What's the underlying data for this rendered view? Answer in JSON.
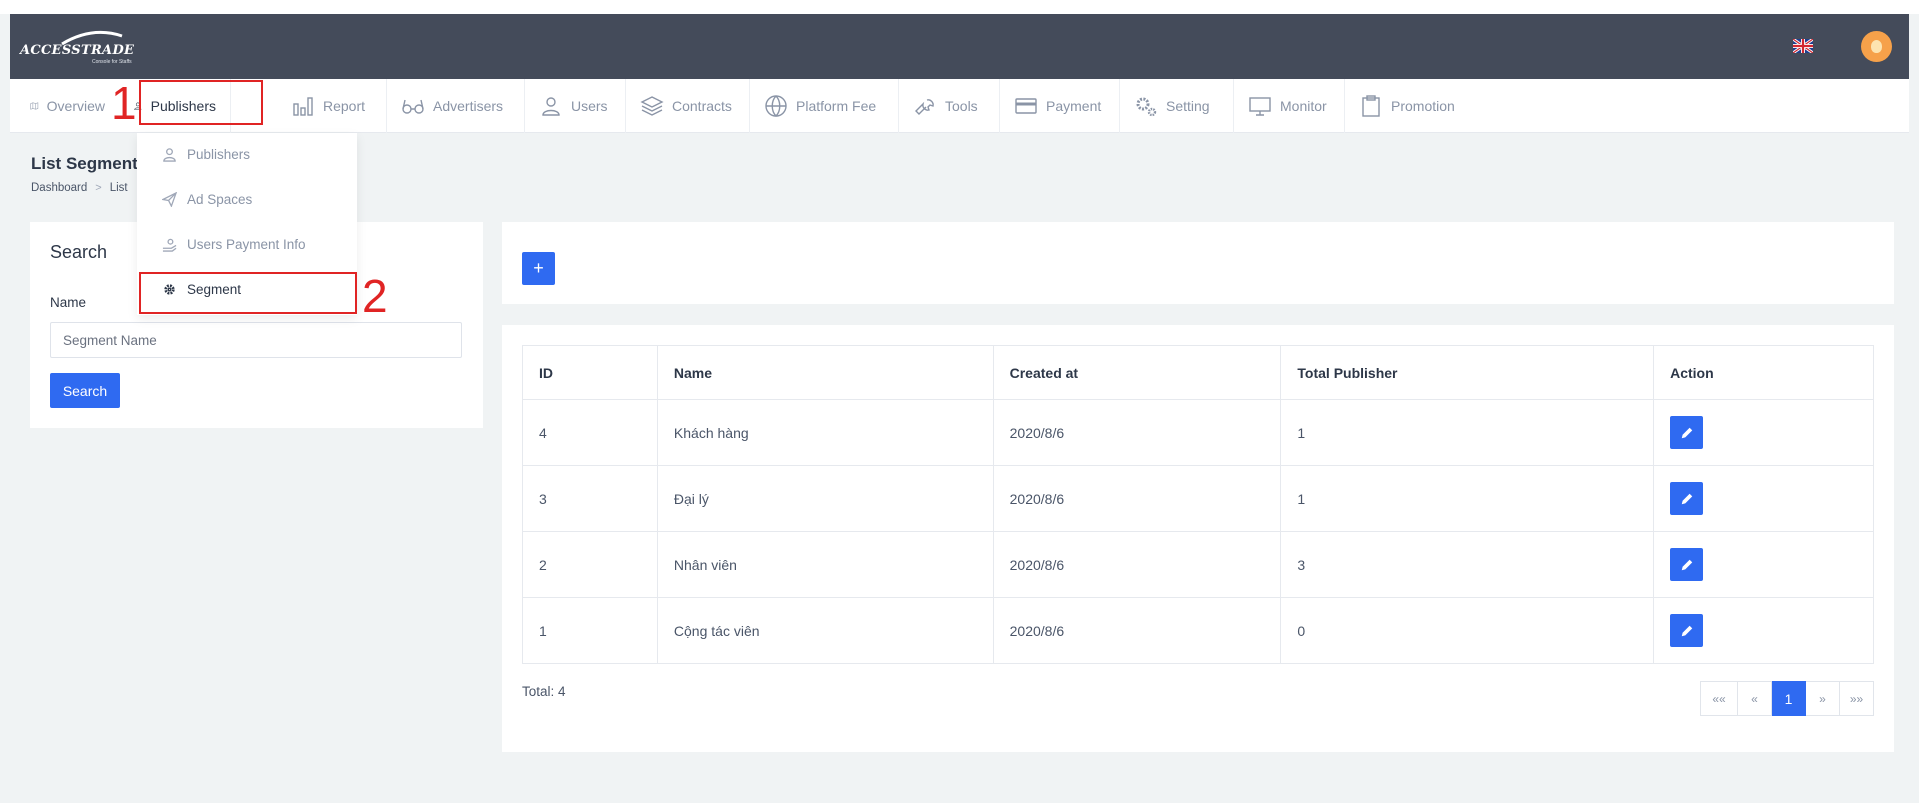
{
  "brand": {
    "logo_text": "ACCESSTRADE",
    "logo_subtext": "Console for Staffs"
  },
  "colors": {
    "topbar": "#444b5a",
    "primary": "#2f6af1",
    "annotation": "#e02424",
    "avatar": "#f6a14a"
  },
  "nav": {
    "items": [
      {
        "label": "Overview",
        "icon": "map-icon"
      },
      {
        "label": "Publishers",
        "icon": "users-icon"
      },
      {
        "label": "Report",
        "icon": "bar-chart-icon"
      },
      {
        "label": "Advertisers",
        "icon": "glasses-icon"
      },
      {
        "label": "Users",
        "icon": "user-icon"
      },
      {
        "label": "Contracts",
        "icon": "layers-icon"
      },
      {
        "label": "Platform Fee",
        "icon": "globe-icon"
      },
      {
        "label": "Tools",
        "icon": "wrench-icon"
      },
      {
        "label": "Payment",
        "icon": "credit-card-icon"
      },
      {
        "label": "Setting",
        "icon": "gears-icon"
      },
      {
        "label": "Monitor",
        "icon": "monitor-icon"
      },
      {
        "label": "Promotion",
        "icon": "clipboard-icon"
      }
    ],
    "active_index": 1
  },
  "dropdown": {
    "items": [
      {
        "label": "Publishers",
        "icon": "users-icon"
      },
      {
        "label": "Ad Spaces",
        "icon": "paper-plane-icon"
      },
      {
        "label": "Users Payment Info",
        "icon": "hand-money-icon"
      },
      {
        "label": "Segment",
        "icon": "gear-icon"
      }
    ],
    "active_index": 3
  },
  "annotations": {
    "step1": "1",
    "step2": "2"
  },
  "page": {
    "title": "List Segment",
    "breadcrumb": [
      "Dashboard",
      "List"
    ]
  },
  "search": {
    "title": "Search",
    "name_label": "Name",
    "name_placeholder": "Segment Name",
    "name_value": "",
    "button_label": "Search"
  },
  "add_button_label": "+",
  "table": {
    "headers": [
      "ID",
      "Name",
      "Created at",
      "Total Publisher",
      "Action"
    ],
    "rows": [
      {
        "id": "4",
        "name": "Khách hàng",
        "created_at": "2020/8/6",
        "total_publisher": "1"
      },
      {
        "id": "3",
        "name": "Đại lý",
        "created_at": "2020/8/6",
        "total_publisher": "1"
      },
      {
        "id": "2",
        "name": "Nhân viên",
        "created_at": "2020/8/6",
        "total_publisher": "3"
      },
      {
        "id": "1",
        "name": "Cộng tác viên",
        "created_at": "2020/8/6",
        "total_publisher": "0"
      }
    ],
    "total_text": "Total: 4"
  },
  "pagination": {
    "first": "««",
    "prev": "«",
    "current": "1",
    "next": "»",
    "last": "»»"
  }
}
